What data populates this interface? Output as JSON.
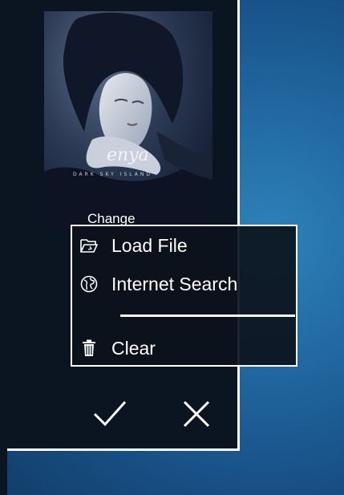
{
  "album": {
    "cover_artist_logo": "enya",
    "cover_subtitle": "DARK SKY ISLAND"
  },
  "change_label": "Change",
  "context_menu": {
    "items": [
      {
        "label": "Load File",
        "icon": "folder-open-icon"
      },
      {
        "label": "Internet Search",
        "icon": "globe-icon"
      },
      {
        "label": "Clear",
        "icon": "trash-icon"
      }
    ]
  },
  "actions": {
    "confirm_icon": "checkmark-icon",
    "cancel_icon": "close-icon"
  },
  "colors": {
    "panel_bg": "#0b1522",
    "border": "#ffffff",
    "desktop": "#1f639c"
  }
}
